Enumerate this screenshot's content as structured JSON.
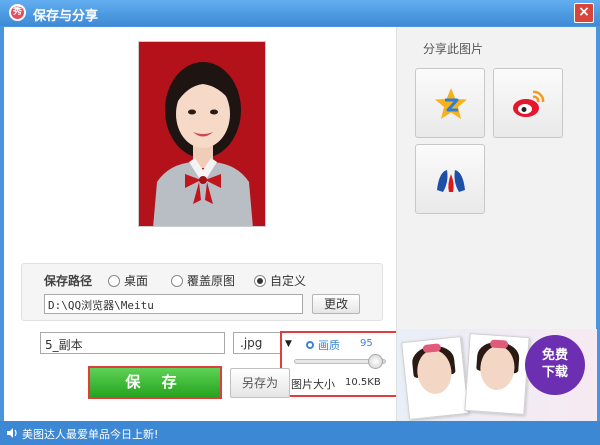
{
  "window": {
    "title": "保存与分享",
    "logo_text": "秀",
    "close_label": "×"
  },
  "save_path": {
    "label": "保存路径",
    "options": [
      {
        "label": "桌面",
        "checked": false
      },
      {
        "label": "覆盖原图",
        "checked": false
      },
      {
        "label": "自定义",
        "checked": true
      }
    ],
    "path_value": "D:\\QQ浏览器\\Meitu",
    "change_label": "更改"
  },
  "file": {
    "name_value": "5_副本",
    "ext_value": ".jpg",
    "ext_arrow": "▼"
  },
  "quality": {
    "label": "画质",
    "value": "95",
    "level_percent": 95,
    "size_label": "图片大小",
    "size_value": "10.5KB"
  },
  "actions": {
    "save_label": "保 存",
    "save_as_label": "另存为"
  },
  "share": {
    "title": "分享此图片",
    "targets": [
      "qzone-icon",
      "weibo-icon",
      "renren-icon"
    ]
  },
  "ad": {
    "cta_line1": "免费",
    "cta_line2": "下载"
  },
  "status": {
    "text": "美图达人最爱单品今日上新!"
  },
  "colors": {
    "accent": "#3c88d4",
    "save_green": "#2aa622",
    "highlight_red": "#e23d3d",
    "photo_bg": "#b4121a"
  }
}
